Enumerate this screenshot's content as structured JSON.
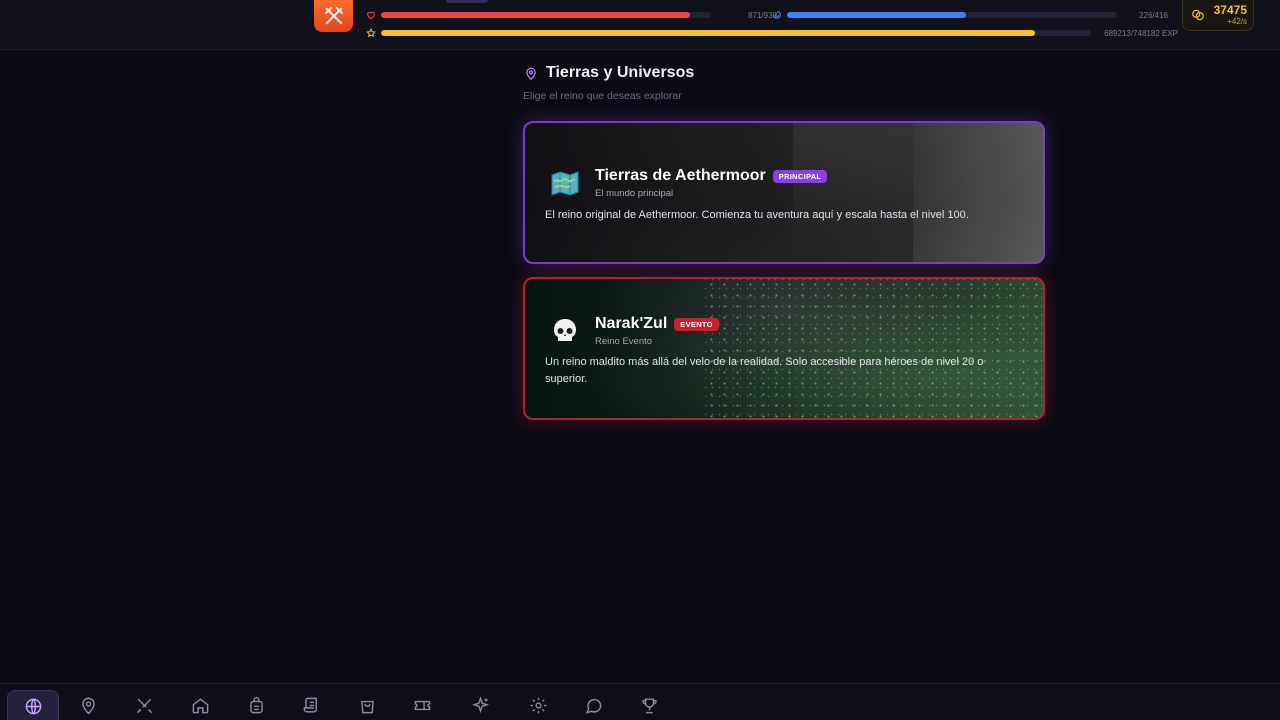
{
  "hud": {
    "health": {
      "current": 871,
      "max": 930,
      "text": "871/930",
      "color": "#ef4450"
    },
    "mana": {
      "current": 226,
      "max": 416,
      "text": "226/416",
      "color": "#3f82f0"
    },
    "exp": {
      "current": 689213,
      "max": 748182,
      "text": "689213/748182 EXP",
      "color": "#f2c230"
    },
    "gold": {
      "amount": "37475",
      "rate": "+42/s"
    }
  },
  "main": {
    "title": "Tierras y Universos",
    "subtitle": "Elige el reino que deseas explorar"
  },
  "realms": [
    {
      "name": "Tierras de Aethermoor",
      "badge": "PRINCIPAL",
      "subtitle": "El mundo principal",
      "description": "El reino original de Aethermoor. Comienza tu aventura aquí y escala hasta el nivel 100.",
      "icon": "map-icon"
    },
    {
      "name": "Narak'Zul",
      "badge": "EVENTO",
      "subtitle": "Reino Evento",
      "description": "Un reino maldito más allá del velo de la realidad. Solo accesible para héroes de nivel 20 o superior.",
      "icon": "skull-icon"
    }
  ],
  "nav": {
    "items": [
      "globe-icon",
      "map-pin-icon",
      "swords-icon",
      "home-icon",
      "backpack-icon",
      "scroll-icon",
      "shop-bag-icon",
      "ticket-icon",
      "sparkles-icon",
      "gear-icon",
      "chat-icon",
      "trophy-icon"
    ],
    "active": "globe-icon"
  },
  "colors": {
    "accent_purple": "#8a3fe0",
    "accent_red": "#c8202e",
    "background": "#0b0b14"
  }
}
